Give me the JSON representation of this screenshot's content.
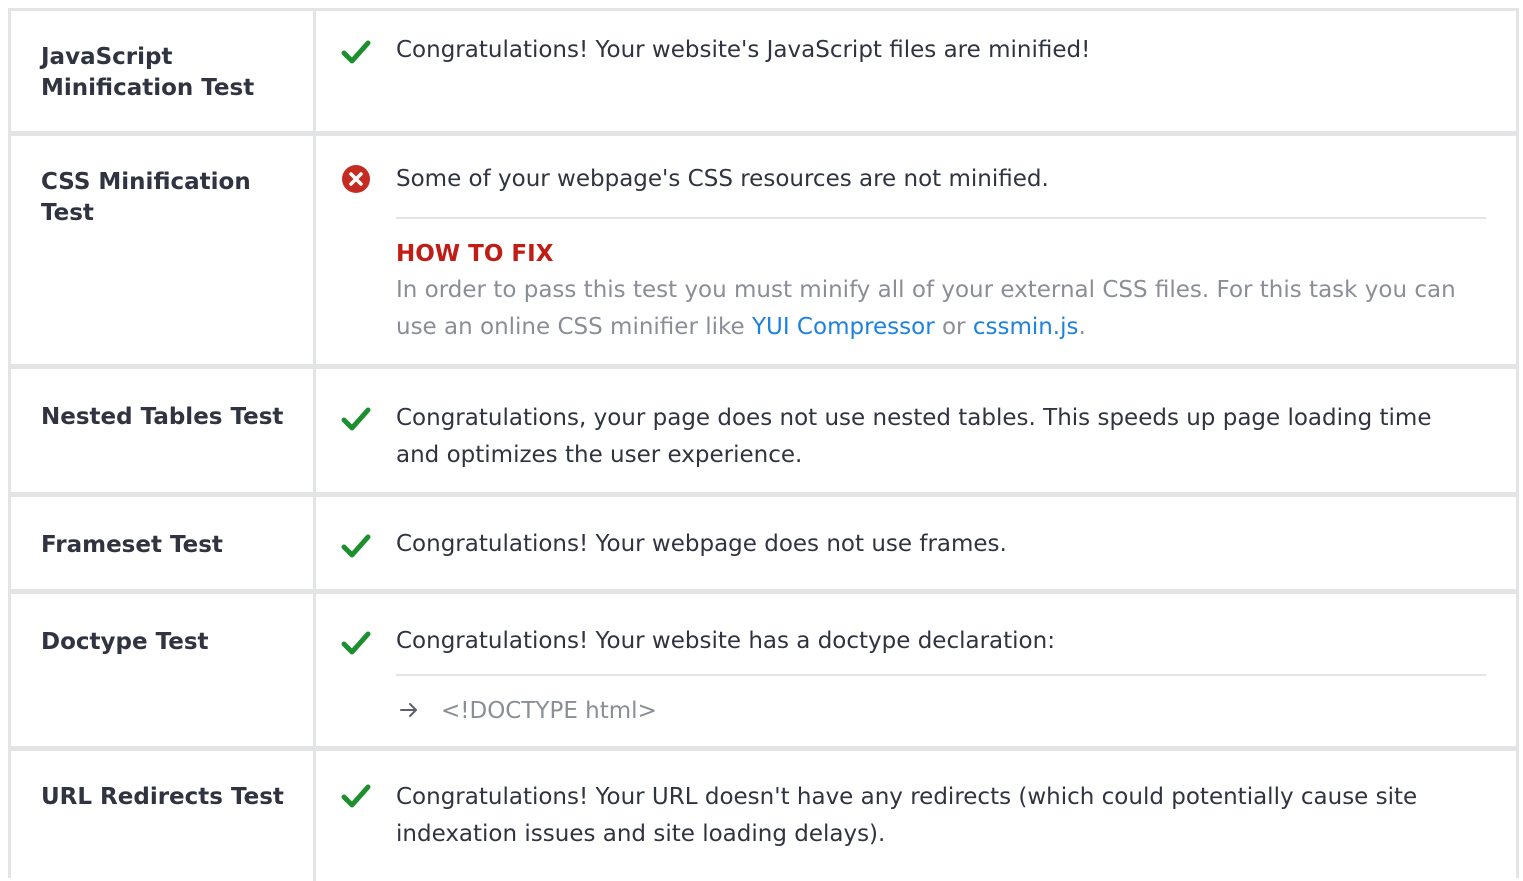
{
  "tests": [
    {
      "name": "JavaScript Minification Test",
      "status": "pass",
      "message": "Congratulations! Your website's JavaScript files are minified!"
    },
    {
      "name": "CSS Minification Test",
      "status": "fail",
      "message": "Some of your webpage's CSS resources are not minified.",
      "fix_title": "HOW TO FIX",
      "fix_text_before": "In order to pass this test you must minify all of your external CSS files. For this task you can use an online CSS minifier like ",
      "fix_link_1": "YUI Compressor",
      "fix_text_middle": " or ",
      "fix_link_2": "cssmin.js",
      "fix_text_after": "."
    },
    {
      "name": "Nested Tables Test",
      "status": "pass",
      "message": "Congratulations, your page does not use nested tables. This speeds up page loading time and optimizes the user experience."
    },
    {
      "name": "Frameset Test",
      "status": "pass",
      "message": "Congratulations! Your webpage does not use frames."
    },
    {
      "name": "Doctype Test",
      "status": "pass",
      "message": "Congratulations! Your website has a doctype declaration:",
      "doctype": "<!DOCTYPE html>"
    },
    {
      "name": "URL Redirects Test",
      "status": "pass",
      "message": "Congratulations! Your URL doesn't have any redirects (which could potentially cause site indexation issues and site loading delays)."
    }
  ],
  "colors": {
    "pass": "#1e8f2e",
    "fail": "#c42b21",
    "link": "#1d82df",
    "fix_title": "#bf1d16"
  },
  "icons": {
    "pass": "check-icon",
    "fail": "error-circle-icon",
    "arrow": "arrow-right-icon"
  }
}
